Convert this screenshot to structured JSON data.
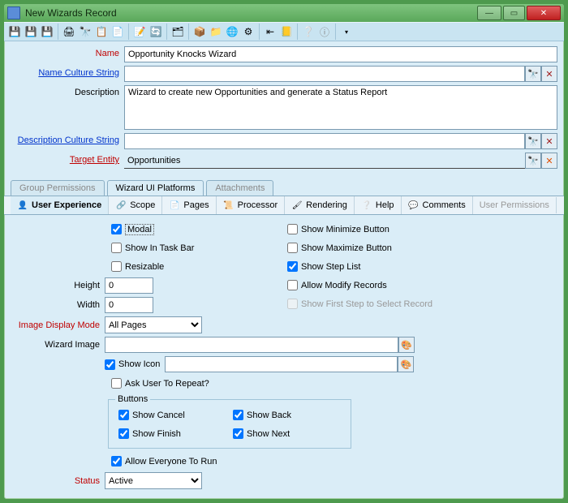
{
  "window": {
    "title": "New Wizards Record"
  },
  "labels": {
    "name": "Name",
    "nameCulture": "Name Culture String",
    "description": "Description",
    "descCulture": "Description Culture String",
    "targetEntity": "Target Entity",
    "height": "Height",
    "width": "Width",
    "imageDisplayMode": "Image Display Mode",
    "wizardImage": "Wizard Image",
    "status": "Status",
    "buttons": "Buttons"
  },
  "values": {
    "name": "Opportunity Knocks Wizard",
    "nameCulture": "",
    "description": "Wizard to create new Opportunities and generate a Status Report",
    "descCulture": "",
    "targetEntity": "Opportunities",
    "height": "0",
    "width": "0",
    "imageDisplayMode": "All Pages",
    "wizardImage": "",
    "iconPath": "",
    "status": "Active"
  },
  "tabs1": {
    "groupPermissions": "Group Permissions",
    "wizardUiPlatforms": "Wizard UI Platforms",
    "attachments": "Attachments"
  },
  "tabs2": {
    "ux": "User Experience",
    "scope": "Scope",
    "pages": "Pages",
    "processor": "Processor",
    "rendering": "Rendering",
    "help": "Help",
    "comments": "Comments",
    "userPerm": "User Permissions"
  },
  "checkboxes": {
    "modal": "Modal",
    "showInTaskBar": "Show In Task Bar",
    "resizable": "Resizable",
    "showMinimize": "Show Minimize Button",
    "showMaximize": "Show Maximize Button",
    "showStepList": "Show Step List",
    "allowModify": "Allow Modify Records",
    "showFirstStep": "Show First Step to Select Record",
    "showIcon": "Show Icon",
    "askRepeat": "Ask User To Repeat?",
    "showCancel": "Show Cancel",
    "showBack": "Show Back",
    "showFinish": "Show Finish",
    "showNext": "Show Next",
    "allowEveryone": "Allow Everyone To Run"
  }
}
